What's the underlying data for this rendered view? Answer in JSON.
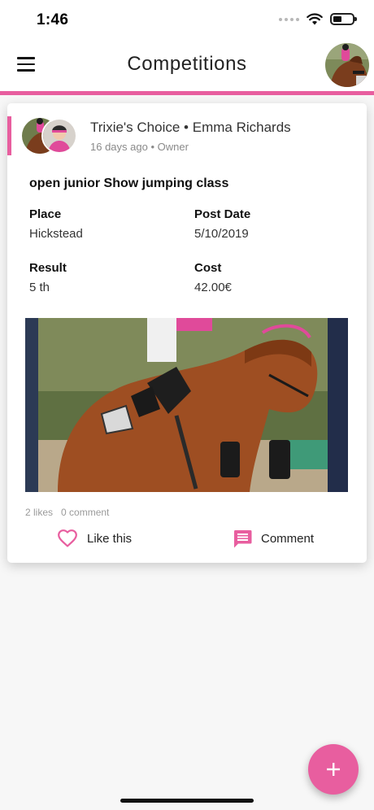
{
  "status_bar": {
    "time": "1:46"
  },
  "header": {
    "title": "Competitions"
  },
  "post": {
    "horse_name": "Trixie's Choice",
    "separator": "•",
    "owner_name": "Emma Richards",
    "time_ago": "16 days ago",
    "meta_separator": "•",
    "role": "Owner",
    "title": "open junior Show jumping class",
    "fields": {
      "place_label": "Place",
      "place_value": "Hickstead",
      "post_date_label": "Post Date",
      "post_date_value": "5/10/2019",
      "result_label": "Result",
      "result_value": "5 th",
      "cost_label": "Cost",
      "cost_value": "42.00€"
    },
    "likes": "2 likes",
    "comments": "0 comment",
    "actions": {
      "like_label": "Like this",
      "comment_label": "Comment"
    }
  },
  "icons": {
    "menu": "hamburger-menu-icon",
    "like": "heart-outline-icon",
    "comment": "comment-bubble-icon",
    "add": "plus-icon"
  },
  "colors": {
    "accent": "#e85e9f",
    "background": "#f7f7f7"
  }
}
